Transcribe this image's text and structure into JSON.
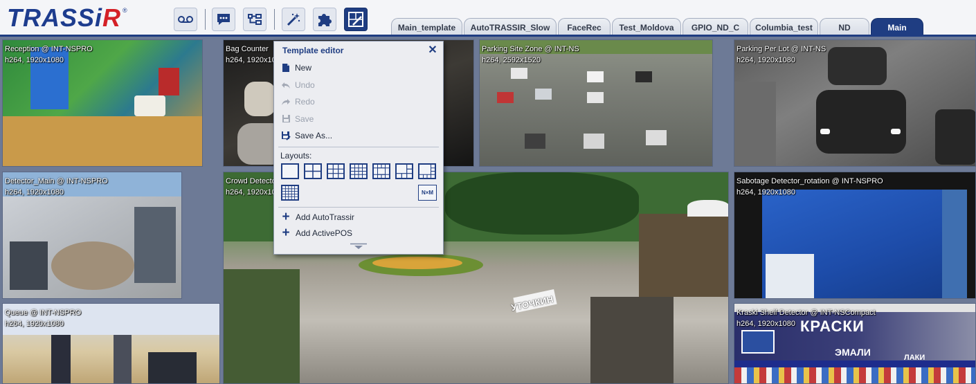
{
  "app": {
    "logo_text_1": "TRASS",
    "logo_text_2": "i",
    "logo_text_3": "R",
    "logo_reg": "®"
  },
  "toolbar": {
    "buttons": [
      {
        "icon": "voicemail-icon"
      },
      {
        "icon": "chat-icon"
      },
      {
        "icon": "hierarchy-icon"
      },
      {
        "icon": "magic-wand-icon"
      },
      {
        "icon": "puzzle-icon"
      },
      {
        "icon": "template-edit-icon",
        "active": true
      }
    ]
  },
  "tabs": [
    {
      "label": "Main_template"
    },
    {
      "label": "AutoTRASSIR_Slow"
    },
    {
      "label": "FaceRec"
    },
    {
      "label": "Test_Moldova"
    },
    {
      "label": "GPIO_ND_C"
    },
    {
      "label": "Columbia_test"
    },
    {
      "label": "ND"
    },
    {
      "label": "Main",
      "active": true
    }
  ],
  "cameras": [
    {
      "name": "Reception @ INT-NSPRO",
      "info": "h264, 1920x1080"
    },
    {
      "name": "Bag Counter",
      "info": "h264, 1920x1080"
    },
    {
      "name": "Parking Site Zone @ INT-NS",
      "info": "h264, 2592x1520"
    },
    {
      "name": "Parking Per Lot @ INT-NS",
      "info": "h264, 1920x1080"
    },
    {
      "name": "Detector_Main @ INT-NSPRO",
      "info": "h264, 1920x1080"
    },
    {
      "name": "Crowd Detector @ INT-NSPRO",
      "info": "h264, 1920x1080"
    },
    {
      "name": "Sabotage Detector_rotation @ INT-NSPRO",
      "info": "h264, 1920x1080"
    },
    {
      "name": "Queue @ INT-NSPRO",
      "info": "h264, 1920x1080"
    },
    {
      "name": "Kraski Shelf Detector @ INT-NSCompact",
      "info": "h264, 1920x1080"
    }
  ],
  "scene_signs": {
    "cafe_sign": "УТОЧКИН",
    "shop_sign_1": "КРАСКИ",
    "shop_sign_2": "ЭМАЛИ",
    "shop_sign_3": "ЛАКИ"
  },
  "template_editor": {
    "title": "Template editor",
    "close_icon": "close-icon",
    "items": [
      {
        "label": "New",
        "icon": "new-document-icon",
        "enabled": true
      },
      {
        "label": "Undo",
        "icon": "undo-icon",
        "enabled": false
      },
      {
        "label": "Redo",
        "icon": "redo-icon",
        "enabled": false
      },
      {
        "label": "Save",
        "icon": "save-icon",
        "enabled": false
      },
      {
        "label": "Save As...",
        "icon": "save-as-icon",
        "enabled": true
      }
    ],
    "layouts_label": "Layouts:",
    "nxm_label": "N×M",
    "add_items": [
      {
        "label": "Add AutoTrassir"
      },
      {
        "label": "Add ActivePOS"
      }
    ]
  },
  "colors": {
    "accent": "#1f3d82",
    "logo_red": "#d42027",
    "grid_background": "#6d7a96",
    "panel": "#ecedf1"
  }
}
